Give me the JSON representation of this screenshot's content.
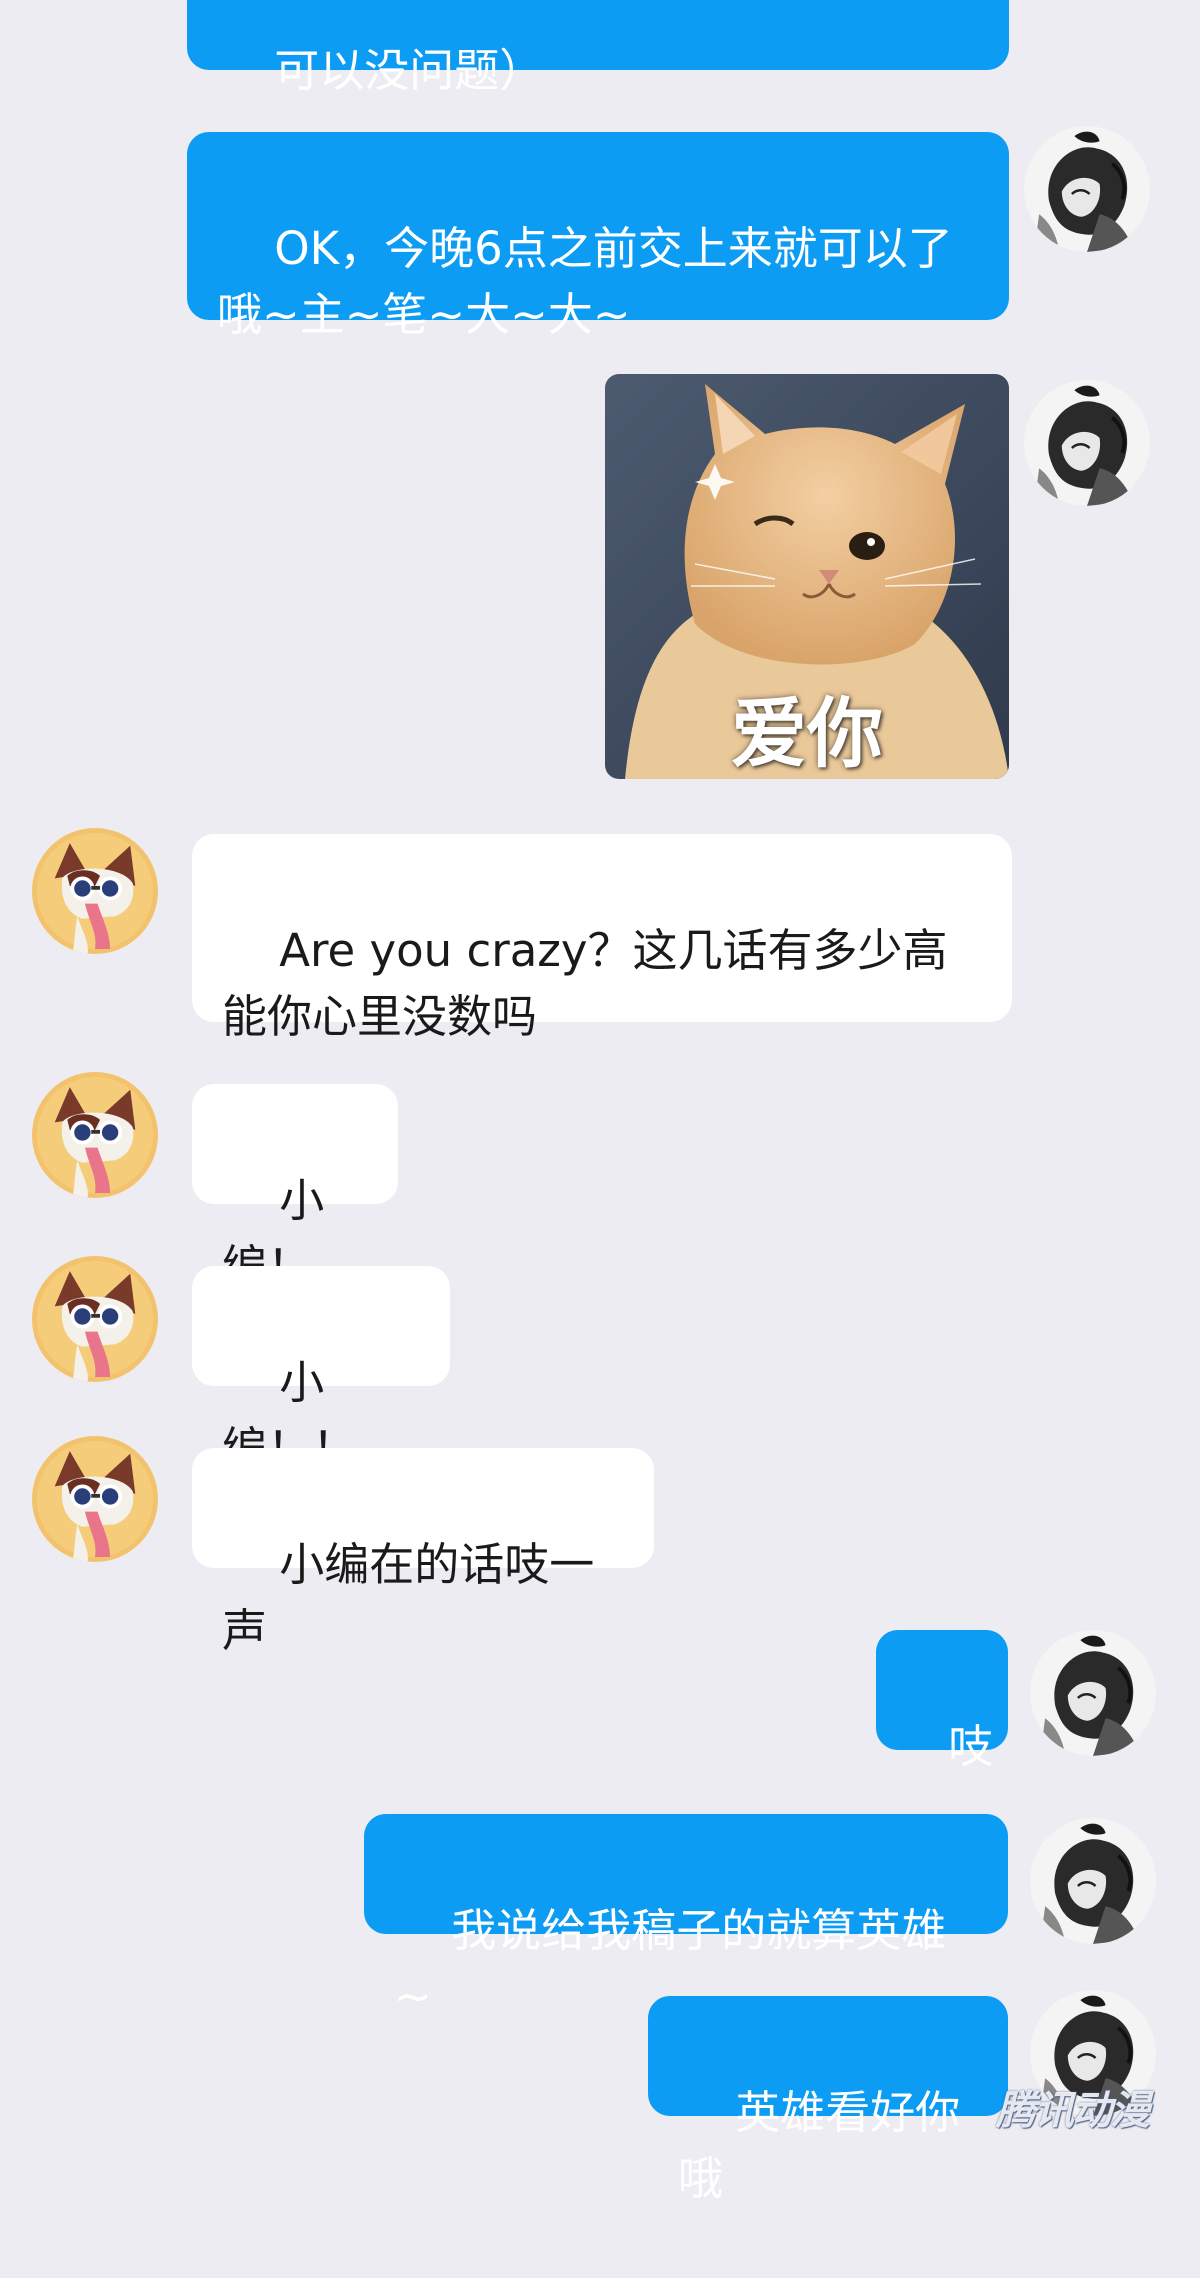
{
  "messages": [
    {
      "side": "right",
      "type": "text",
      "text": "可以没问题）"
    },
    {
      "side": "right",
      "type": "text",
      "text": "OK，今晚6点之前交上来就可以了\n哦~主~笔~大~大~"
    },
    {
      "side": "right",
      "type": "sticker",
      "caption": "爱你"
    },
    {
      "side": "left",
      "type": "text",
      "text": "Are you crazy？这几话有多少高\n能你心里没数吗"
    },
    {
      "side": "left",
      "type": "text",
      "text": "小编！"
    },
    {
      "side": "left",
      "type": "text",
      "text": "小编！！"
    },
    {
      "side": "left",
      "type": "text",
      "text": "小编在的话吱一声"
    },
    {
      "side": "right",
      "type": "text",
      "text": "吱"
    },
    {
      "side": "right",
      "type": "text",
      "text": "我说给我稿子的就算英雄~"
    },
    {
      "side": "right",
      "type": "text",
      "text": "英雄看好你哦"
    }
  ],
  "watermark": "腾讯动漫",
  "colors": {
    "background": "#ececf2",
    "sent_bubble": "#0c9cf3",
    "received_bubble": "#ffffff"
  },
  "icons": {
    "sender_avatar": "ink-portrait-avatar-icon",
    "receiver_avatar": "cartoon-cat-avatar-icon"
  }
}
